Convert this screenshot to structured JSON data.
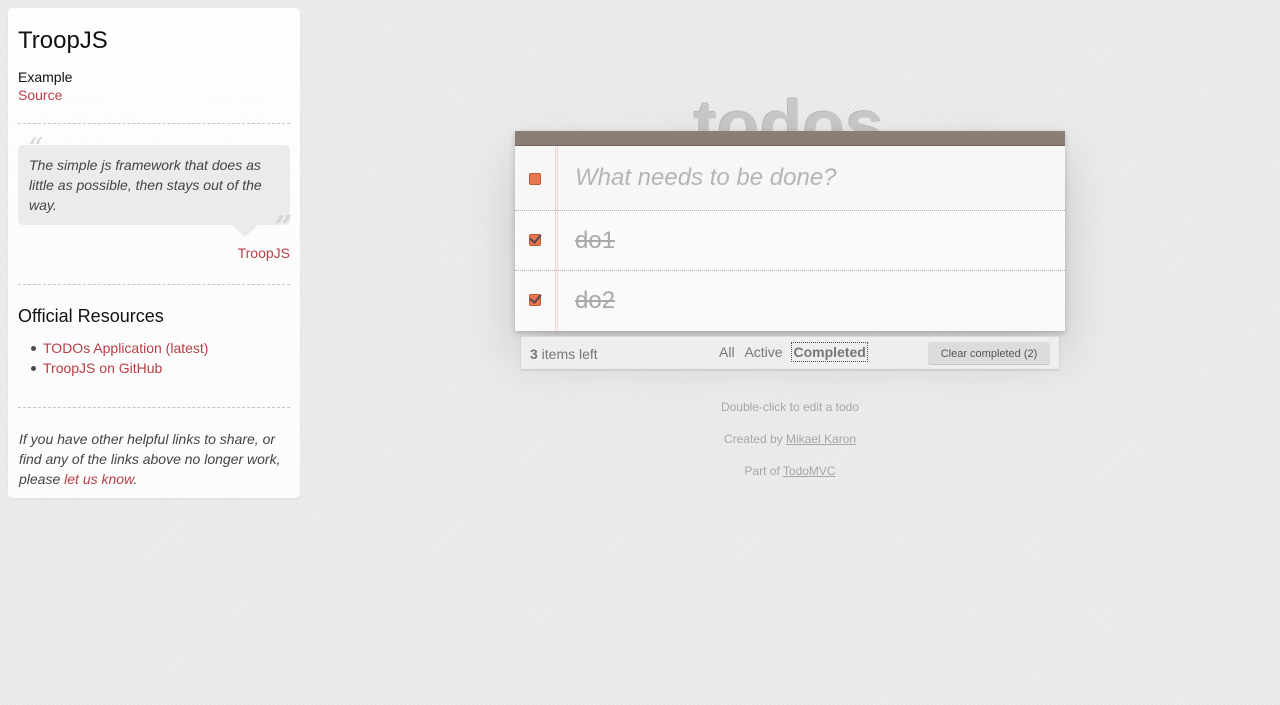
{
  "sidebar": {
    "title": "TroopJS",
    "example_label": "Example",
    "source_link": "Source",
    "quote": "The simple js framework that does as little as possible, then stays out of the way.",
    "quote_author": "TroopJS",
    "resources_title": "Official Resources",
    "resources": [
      {
        "label": "TODOs Application (latest)"
      },
      {
        "label": "TroopJS on GitHub"
      }
    ],
    "footer_text_before": "If you have other helpful links to share, or find any of the links above no longer work, please ",
    "footer_link": "let us know",
    "footer_text_after": "."
  },
  "app": {
    "title": "todos",
    "new_todo_placeholder": "What needs to be done?",
    "new_todo_value": "",
    "todos": [
      {
        "label": "do1",
        "completed": true
      },
      {
        "label": "do2",
        "completed": true
      }
    ],
    "footer": {
      "count": "3",
      "count_suffix": " items left",
      "filters": [
        {
          "label": "All",
          "selected": false
        },
        {
          "label": "Active",
          "selected": false
        },
        {
          "label": "Completed",
          "selected": true
        }
      ],
      "clear_completed": "Clear completed (2)"
    }
  },
  "info": {
    "edit_hint": "Double-click to edit a todo",
    "created_by_prefix": "Created by ",
    "author": "Mikael Karon",
    "part_of_prefix": "Part of ",
    "part_of_link": "TodoMVC"
  },
  "colors": {
    "accent": "#b83f45",
    "header_bar": "#8d7d77",
    "checkbox": "#e8764f"
  }
}
